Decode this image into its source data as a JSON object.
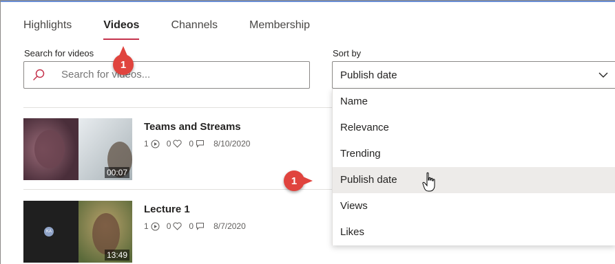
{
  "tabs": [
    {
      "label": "Highlights",
      "active": false
    },
    {
      "label": "Videos",
      "active": true
    },
    {
      "label": "Channels",
      "active": false
    },
    {
      "label": "Membership",
      "active": false
    }
  ],
  "search": {
    "label": "Search for videos",
    "placeholder": "Search for videos..."
  },
  "sort": {
    "label": "Sort by",
    "selected": "Publish date",
    "options": [
      "Name",
      "Relevance",
      "Trending",
      "Publish date",
      "Views",
      "Likes"
    ],
    "hovered": "Publish date"
  },
  "videos": [
    {
      "title": "Teams and Streams",
      "views": "1",
      "likes": "0",
      "comments": "0",
      "date": "8/10/2020",
      "duration": "00:07"
    },
    {
      "title": "Lecture 1",
      "views": "1",
      "likes": "0",
      "comments": "0",
      "date": "8/7/2020",
      "duration": "13:49",
      "avatar_initials": "KA"
    }
  ],
  "callouts": {
    "tab_badge": "1",
    "dropdown_badge": "1"
  },
  "colors": {
    "accent": "#c4314b",
    "badge": "#e0443e",
    "hover": "#edebe9"
  }
}
